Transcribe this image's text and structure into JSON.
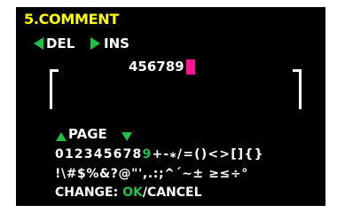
{
  "title": "5.COMMENT",
  "nav": {
    "del_label": "DEL",
    "ins_label": "INS"
  },
  "entry": {
    "text": "456789"
  },
  "page_label": "PAGE",
  "charset": {
    "row1_before": "012345678",
    "row1_selected": "9",
    "row1_after": "+-⁎/=()<>[]{}",
    "row2": "!\\#$%&?@\"',.:;^´∼± ≥≤÷°"
  },
  "footer": {
    "change_label": "CHANGE: ",
    "ok_label": "OK",
    "cancel_label": "/CANCEL"
  },
  "colors": {
    "background": "#000000",
    "title": "#ffff00",
    "accent": "#22c04a",
    "cursor": "#ff1493",
    "text": "#ffffff"
  }
}
